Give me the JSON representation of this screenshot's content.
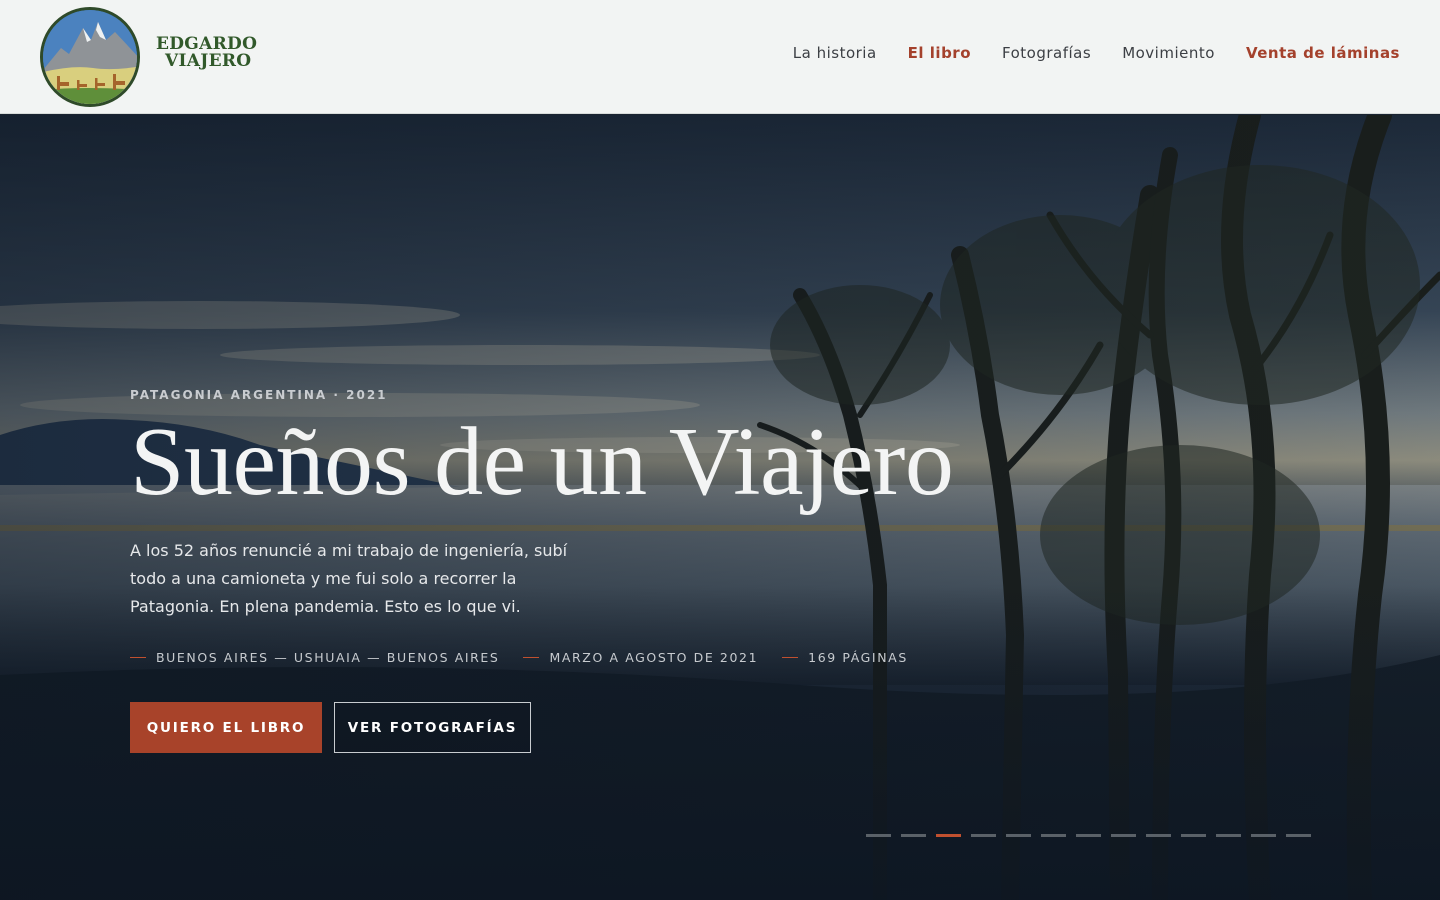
{
  "header": {
    "brand_line1": "EDGARDO",
    "brand_line2": "VIAJERO",
    "nav": [
      {
        "label": "La historia",
        "accent": false
      },
      {
        "label": "El libro",
        "accent": true
      },
      {
        "label": "Fotografías",
        "accent": false
      },
      {
        "label": "Movimiento",
        "accent": false
      },
      {
        "label": "Venta de láminas",
        "accent": true
      }
    ]
  },
  "hero": {
    "eyebrow": "PATAGONIA ARGENTINA · 2021",
    "title": "Sueños de un Viajero",
    "lead": "A los 52 años renuncié a mi trabajo de ingeniería, subí todo a una camioneta y me fui solo a recorrer la Patagonia. En plena pandemia. Esto es lo que vi.",
    "meta": [
      "BUENOS AIRES — USHUAIA — BUENOS AIRES",
      "MARZO A AGOSTO DE 2021",
      "169 PÁGINAS"
    ],
    "primary_button": "QUIERO EL LIBRO",
    "secondary_button": "VER FOTOGRAFÍAS",
    "slider": {
      "total": 13,
      "active_index": 2
    }
  },
  "colors": {
    "accent": "#a8432a",
    "brand_green": "#31592a",
    "header_bg": "#f2f4f3"
  }
}
